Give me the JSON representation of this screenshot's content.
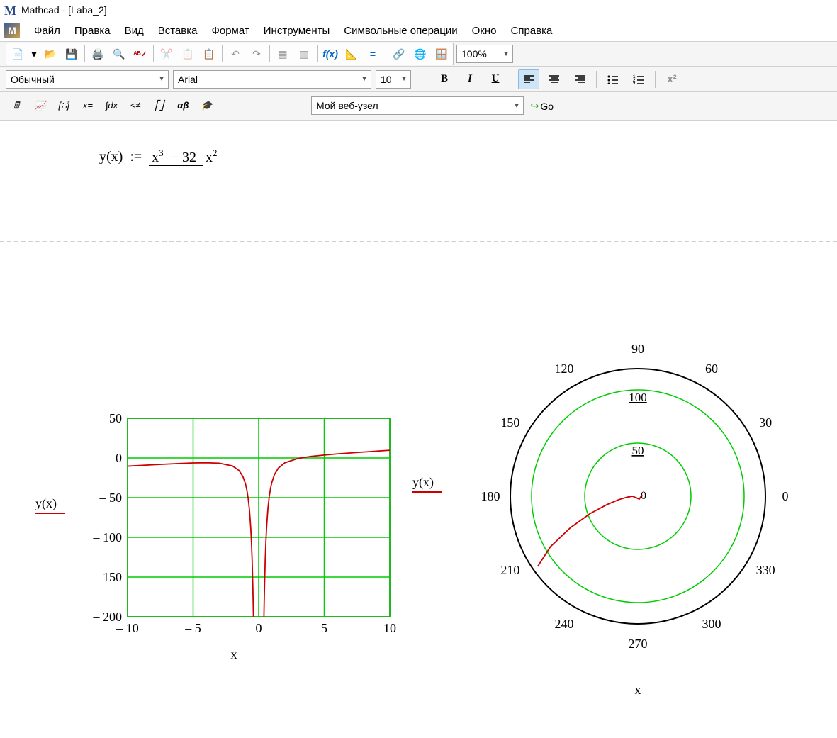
{
  "title": "Mathcad - [Laba_2]",
  "menu": [
    "Файл",
    "Правка",
    "Вид",
    "Вставка",
    "Формат",
    "Инструменты",
    "Символьные операции",
    "Окно",
    "Справка"
  ],
  "toolbar": {
    "zoom": "100%"
  },
  "format": {
    "style": "Обычный",
    "font": "Arial",
    "size": "10"
  },
  "web": {
    "label": "Мой веб-узел",
    "go": "Go"
  },
  "equation": {
    "lhs": "y(x)",
    "assign": ":=",
    "num_base": "x",
    "num_exp": "3",
    "num_minus": "− 32",
    "den_base": "x",
    "den_exp": "2"
  },
  "chart_data": [
    {
      "type": "line",
      "title": "",
      "xlabel": "x",
      "ylabel": "y(x)",
      "xlim": [
        -10,
        10
      ],
      "ylim": [
        -200,
        50
      ],
      "x_ticks": [
        -10,
        -5,
        0,
        5,
        10
      ],
      "y_ticks": [
        -200,
        -150,
        -100,
        -50,
        0,
        50
      ],
      "series": [
        {
          "name": "y(x)",
          "color": "#c00000",
          "x": [
            -10,
            -8,
            -6,
            -5,
            -4,
            -3,
            -2,
            -1.5,
            -1.2,
            -1,
            -0.9,
            -0.8,
            -0.7,
            -0.6,
            -0.55,
            -0.5,
            -0.45,
            -0.42,
            -0.4,
            0.4,
            0.42,
            0.45,
            0.5,
            0.55,
            0.6,
            0.7,
            0.8,
            0.9,
            1,
            1.2,
            1.5,
            2,
            3,
            4,
            5,
            6,
            8,
            10
          ],
          "y": [
            -10.32,
            -8.5,
            -6.89,
            -6.28,
            -6.0,
            -6.56,
            -10,
            -15.7,
            -23.42,
            -33,
            -40.4,
            -51,
            -66.0,
            -89.5,
            -106.3,
            -128.5,
            -158.5,
            -181.8,
            -200.1,
            -200.1,
            -181.3,
            -157.6,
            -127.5,
            -105.2,
            -88.3,
            -64.6,
            -49.2,
            -38.6,
            -31,
            -20.99,
            -12.72,
            -6,
            -0.56,
            2.0,
            3.72,
            5.11,
            7.5,
            9.68
          ]
        }
      ]
    },
    {
      "type": "polar",
      "title": "",
      "xlabel": "x",
      "ylabel": "y(x)",
      "angle_ticks": [
        0,
        30,
        60,
        90,
        120,
        150,
        180,
        210,
        240,
        270,
        300,
        330
      ],
      "r_ticks": [
        0,
        50,
        100
      ],
      "r_max": 120,
      "series": [
        {
          "name": "y(x)",
          "color": "#c00000",
          "theta_deg": [
            180,
            185,
            190,
            195,
            200,
            205,
            210,
            215
          ],
          "r": [
            5,
            10,
            18,
            30,
            48,
            70,
            95,
            115
          ]
        }
      ]
    }
  ]
}
